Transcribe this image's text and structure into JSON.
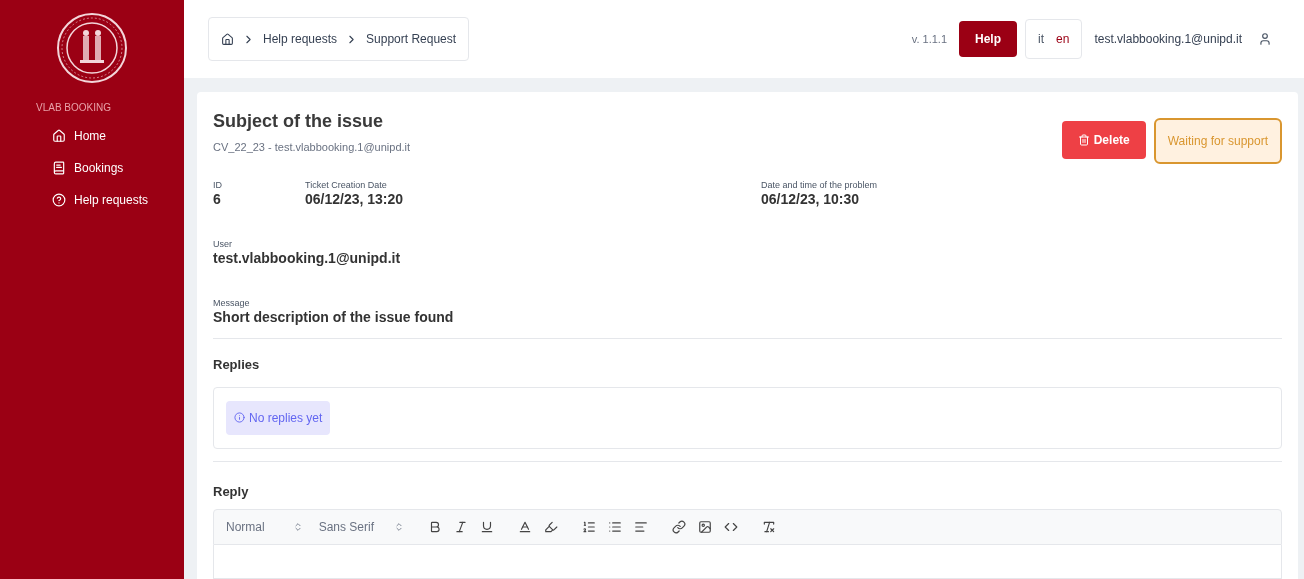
{
  "sidebar": {
    "brand": "VLAB BOOKING",
    "items": [
      {
        "kind": "home",
        "label": "Home"
      },
      {
        "kind": "book",
        "label": "Bookings"
      },
      {
        "kind": "help",
        "label": "Help requests"
      }
    ]
  },
  "breadcrumb": [
    "Help requests",
    "Support Request"
  ],
  "header": {
    "version": "v. 1.1.1",
    "help_button": "Help",
    "languages": [
      {
        "label": "it",
        "selected": false
      },
      {
        "label": "en",
        "selected": true
      }
    ],
    "user": "test.vlabbooking.1@unipd.it"
  },
  "ticket": {
    "title": "Subject of the issue",
    "subtitle": "CV_22_23 - test.vlabbooking.1@unipd.it",
    "delete_button": "Delete",
    "status": "Waiting for support",
    "fields": [
      {
        "label": "ID",
        "value": "6"
      },
      {
        "label": "Ticket Creation Date",
        "value": "06/12/23, 13:20"
      },
      {
        "label": "Date and time of the problem",
        "value": "06/12/23, 10:30"
      }
    ],
    "user": {
      "label": "User",
      "value": "test.vlabbooking.1@unipd.it"
    },
    "message": {
      "label": "Message",
      "value": "Short description of the issue found"
    }
  },
  "replies": {
    "heading": "Replies",
    "empty_notice": "No replies yet"
  },
  "reply_editor": {
    "heading": "Reply",
    "format_select": "Normal",
    "font_select": "Sans Serif"
  }
}
